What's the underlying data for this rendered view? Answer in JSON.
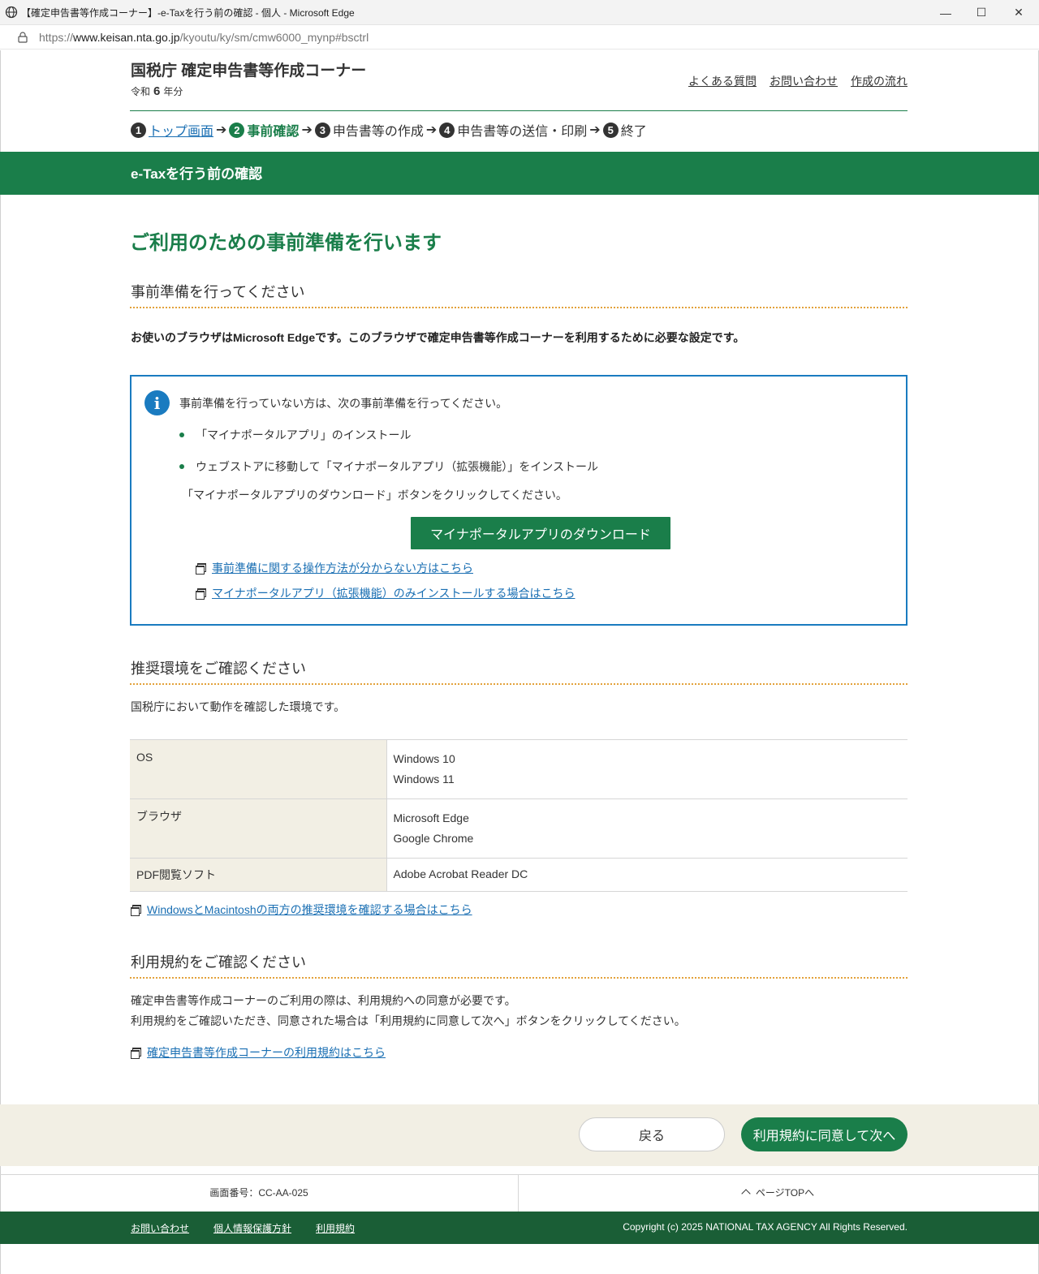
{
  "window": {
    "title": "【確定申告書等作成コーナー】-e-Taxを行う前の確認 - 個人 - Microsoft Edge",
    "url_scheme": "https://",
    "url_host": "www.keisan.nta.go.jp",
    "url_path": "/kyoutu/ky/sm/cmw6000_mynp#bsctrl"
  },
  "header": {
    "site_title": "国税庁 確定申告書等作成コーナー",
    "year_prefix": "令和",
    "year_num": "6",
    "year_suffix": "年分",
    "links": [
      "よくある質問",
      "お問い合わせ",
      "作成の流れ"
    ]
  },
  "steps": [
    {
      "num": "1",
      "label": "トップ画面"
    },
    {
      "num": "2",
      "label": "事前確認"
    },
    {
      "num": "3",
      "label": "申告書等の作成"
    },
    {
      "num": "4",
      "label": "申告書等の送信・印刷"
    },
    {
      "num": "5",
      "label": "終了"
    }
  ],
  "step_arrow": "➔",
  "band_title": "e-Taxを行う前の確認",
  "main_heading": "ご利用のための事前準備を行います",
  "prep": {
    "heading": "事前準備を行ってください",
    "browser_note": "お使いのブラウザはMicrosoft Edgeです。このブラウザで確定申告書等作成コーナーを利用するために必要な設定です。",
    "info_icon": "i",
    "info_intro": "事前準備を行っていない方は、次の事前準備を行ってください。",
    "bullets": [
      "「マイナポータルアプリ」のインストール",
      "ウェブストアに移動して「マイナポータルアプリ（拡張機能）」をインストール"
    ],
    "instruction": "「マイナポータルアプリのダウンロード」ボタンをクリックしてください。",
    "download_button": "マイナポータルアプリのダウンロード",
    "links": [
      "事前準備に関する操作方法が分からない方はこちら",
      "マイナポータルアプリ（拡張機能）のみインストールする場合はこちら"
    ]
  },
  "env": {
    "heading": "推奨環境をご確認ください",
    "intro": "国税庁において動作を確認した環境です。",
    "rows": [
      {
        "key": "OS",
        "values": [
          "Windows 10",
          "Windows 11"
        ]
      },
      {
        "key": "ブラウザ",
        "values": [
          "Microsoft Edge",
          "Google Chrome"
        ]
      },
      {
        "key": "PDF閲覧ソフト",
        "values": [
          "Adobe Acrobat Reader DC"
        ]
      }
    ],
    "link": "WindowsとMacintoshの両方の推奨環境を確認する場合はこちら"
  },
  "terms": {
    "heading": "利用規約をご確認ください",
    "line1": "確定申告書等作成コーナーのご利用の際は、利用規約への同意が必要です。",
    "line2": "利用規約をご確認いただき、同意された場合は「利用規約に同意して次へ」ボタンをクリックしてください。",
    "link": "確定申告書等作成コーナーの利用規約はこちら"
  },
  "actions": {
    "back": "戻る",
    "next": "利用規約に同意して次へ"
  },
  "footer": {
    "screen_id": "画面番号：CC-AA-025",
    "page_top": "ページTOPへ",
    "links": [
      "お問い合わせ",
      "個人情報保護方針",
      "利用規約"
    ],
    "copyright": "Copyright (c) 2025 NATIONAL TAX AGENCY All Rights Reserved."
  },
  "colors": {
    "brand_green": "#1a7e4a",
    "footer_green": "#1a5e36",
    "info_blue": "#1a7bc0",
    "dotted_orange": "#e3a23b",
    "beige": "#f2efe4"
  }
}
